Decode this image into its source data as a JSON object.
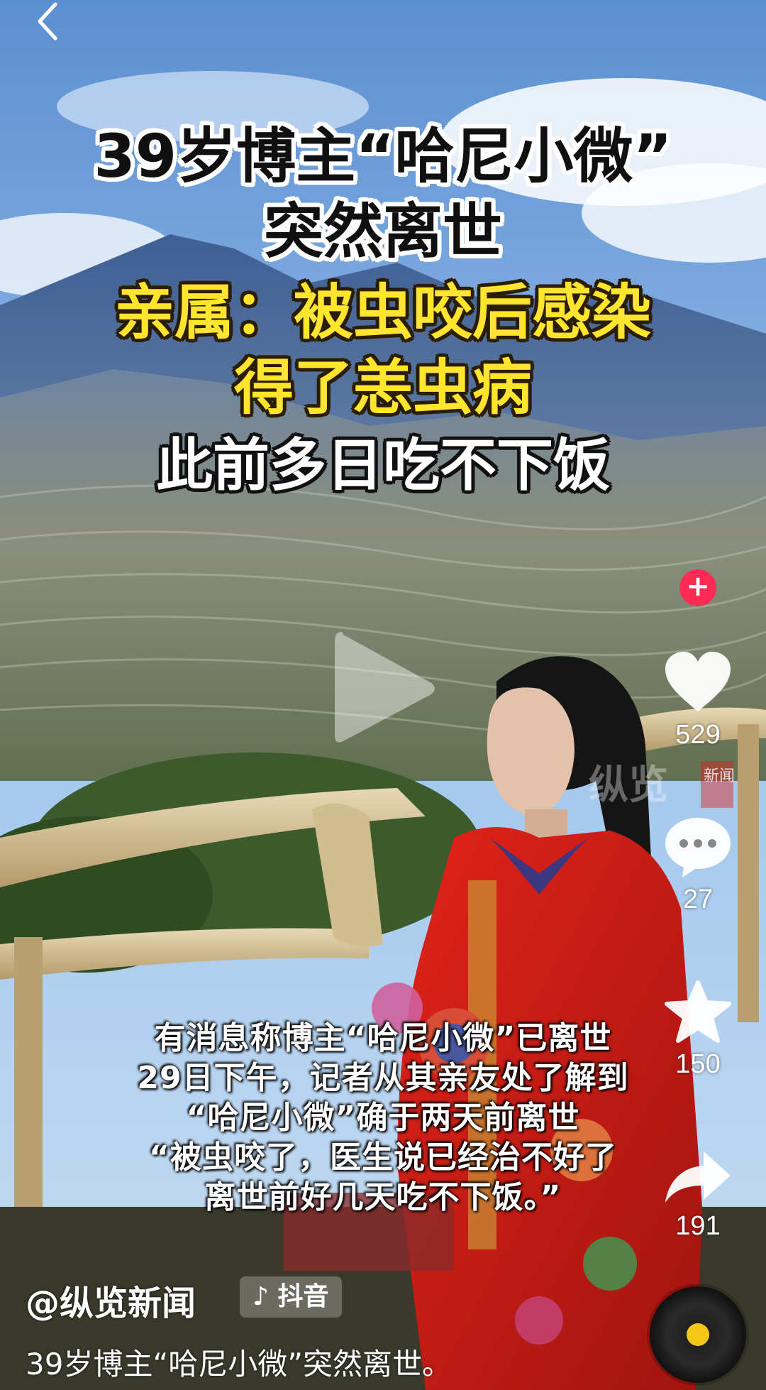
{
  "nav": {
    "back_icon": "chevron-left-icon"
  },
  "video": {
    "headline": [
      "39岁博主“哈尼小微”",
      "突然离世",
      "亲属：被虫咬后感染",
      "得了恙虫病",
      "此前多日吃不下饭"
    ],
    "watermark": "纵览",
    "watermark_sub": "新闻",
    "subtitles": [
      "有消息称博主“哈尼小微”已离世",
      "29日下午，记者从其亲友处了解到",
      "“哈尼小微”确于两天前离世",
      "“被虫咬了，医生说已经治不好了",
      "离世前好几天吃不下饭。”"
    ]
  },
  "actions": {
    "follow_icon": "plus-icon",
    "like_count": "529",
    "comment_count": "27",
    "favorite_count": "150",
    "share_count": "191"
  },
  "meta": {
    "author": "@纵览新闻",
    "platform": "抖音",
    "caption": "39岁博主“哈尼小微”突然离世。"
  },
  "colors": {
    "follow_accent": "#fe2c55",
    "headline_yellow": "#ffe52e",
    "disc_center": "#f5c518"
  }
}
